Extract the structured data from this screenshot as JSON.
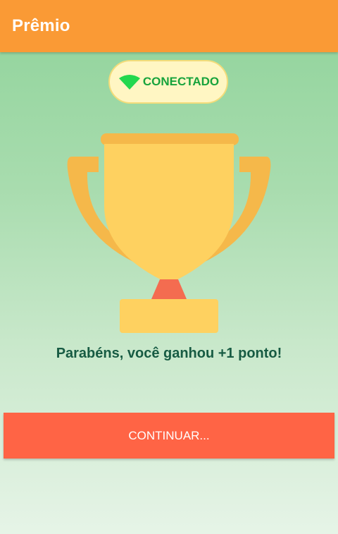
{
  "header": {
    "title": "Prêmio",
    "background_color": "#fa9a35"
  },
  "connection": {
    "status_label": "CONECTADO",
    "icon": "wifi-icon",
    "status_color": "#17a33c"
  },
  "reward": {
    "image": "trophy-icon",
    "message": "Parabéns, você ganhou +1 ponto!"
  },
  "actions": {
    "continue_label": "CONTINUAR...",
    "continue_color": "#ff6445"
  }
}
